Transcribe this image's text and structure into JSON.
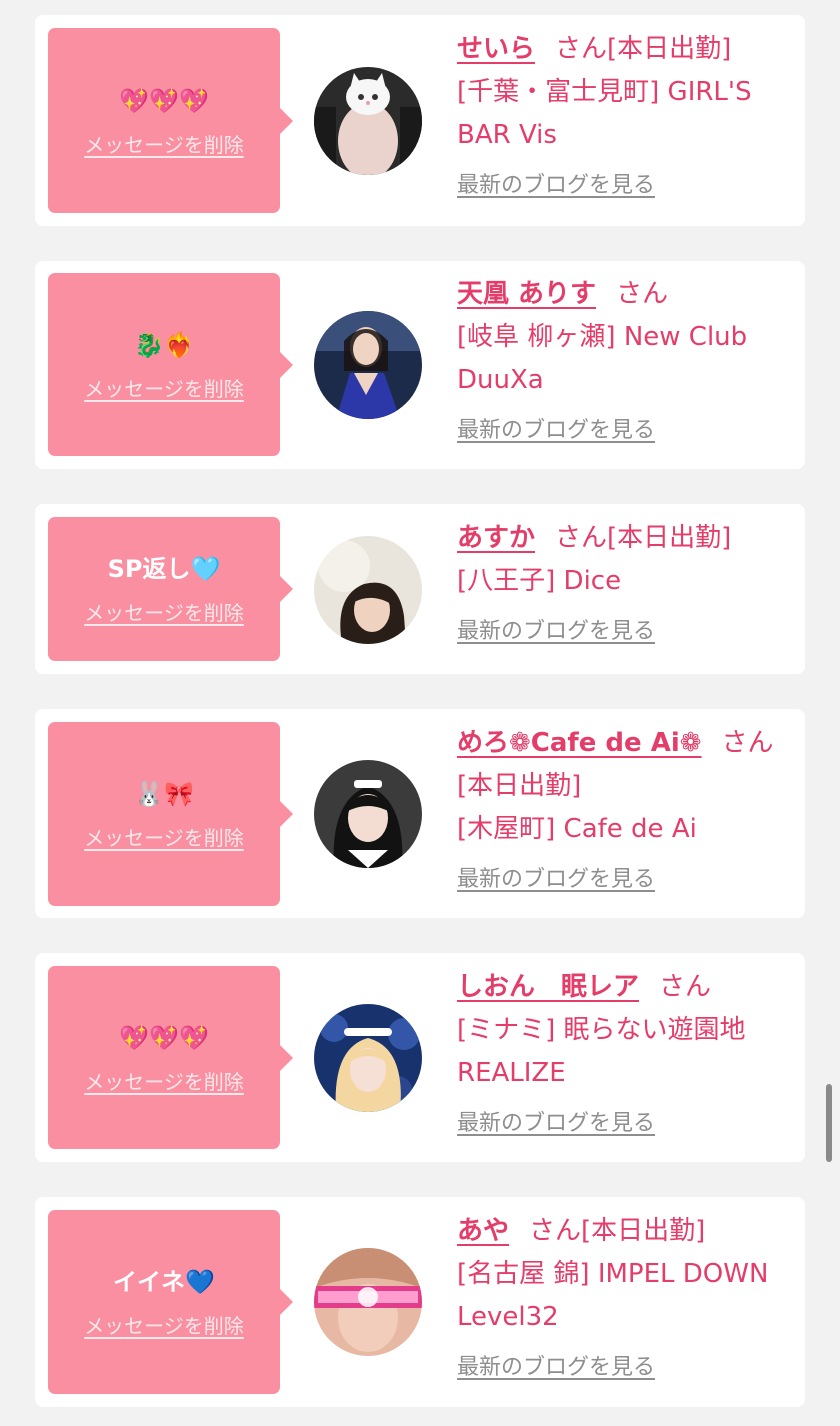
{
  "messages": [
    {
      "reply": "💖💖💖",
      "delete_label": "メッセージを削除",
      "name": "せいら",
      "status": "さん[本日出勤]",
      "shop": "[千葉・富士見町] GIRL'S BAR Vis",
      "blog_label": "最新のブログを見る"
    },
    {
      "reply": "🐉❤️‍🔥",
      "delete_label": "メッセージを削除",
      "name": "天凰 ありす",
      "status": "さん",
      "shop": "[岐阜 柳ヶ瀬] New Club DuuXa",
      "blog_label": "最新のブログを見る"
    },
    {
      "reply": "SP返し🩵",
      "delete_label": "メッセージを削除",
      "name": "あすか",
      "status": "さん[本日出勤]",
      "shop": "[八王子] Dice",
      "blog_label": "最新のブログを見る"
    },
    {
      "reply": "🐰🎀",
      "delete_label": "メッセージを削除",
      "name": "めろ❁Cafe de Ai❁",
      "status": "さん[本日出勤]",
      "shop": "[木屋町] Cafe de Ai",
      "blog_label": "最新のブログを見る"
    },
    {
      "reply": "💖💖💖",
      "delete_label": "メッセージを削除",
      "name": "しおん　眠レア",
      "status": "さん",
      "shop": "[ミナミ] 眠らない遊園地REALIZE",
      "blog_label": "最新のブログを見る"
    },
    {
      "reply": "イイネ💙",
      "delete_label": "メッセージを削除",
      "name": "あや",
      "status": "さん[本日出勤]",
      "shop": "[名古屋 錦] IMPEL DOWN Level32",
      "blog_label": "最新のブログを見る"
    }
  ]
}
